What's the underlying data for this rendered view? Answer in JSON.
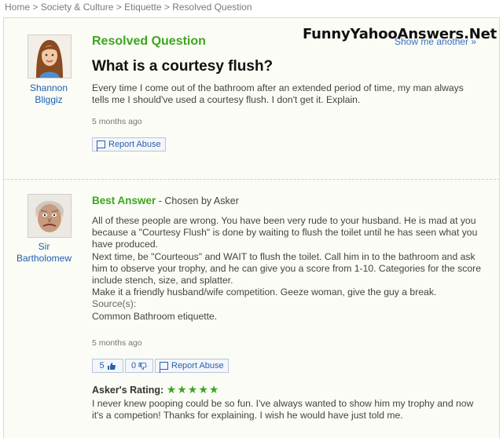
{
  "breadcrumb": {
    "items": [
      "Home",
      "Society & Culture",
      "Etiquette"
    ],
    "separator": ">",
    "current": "Resolved Question"
  },
  "watermark": "FunnyYahooAnswers.Net",
  "show_more": "Show me another »",
  "question": {
    "section_label": "Resolved Question",
    "title": "What is a courtesy flush?",
    "asker": {
      "name_line1": "Shannon",
      "name_line2": "Bliggiz"
    },
    "body": "Every time I come out of the bathroom after an extended period of time, my man always tells me I should've used a courtesy flush. I don't get it. Explain.",
    "time": "5 months ago",
    "report_label": "Report Abuse"
  },
  "answer": {
    "section_label": "Best Answer",
    "chosen_by": " - Chosen by Asker",
    "answerer": {
      "name_line1": "Sir",
      "name_line2": "Bartholomew"
    },
    "paragraphs": [
      "All of these people are wrong. You have been very rude to your husband. He is mad at you because a \"Courtesy Flush\" is done by waiting to flush the toilet until he has seen what you have produced.",
      "Next time, be \"Courteous\" and WAIT to flush the toilet. Call him in to the bathroom and ask him to observe your trophy, and he can give you a score from 1-10. Categories for the score include stench, size, and splatter.",
      "Make it a friendly husband/wife competition. Geeze woman, give the guy a break."
    ],
    "sources_label": "Source(s):",
    "source": "Common Bathroom etiquette.",
    "time": "5 months ago",
    "thumbs_up": "5",
    "thumbs_down": "0",
    "report_label": "Report Abuse",
    "rating_label": "Asker's Rating:",
    "rating_stars": "★★★★★",
    "rating_value": 5,
    "rating_comment": "I never knew pooping could be so fun. I've always wanted to show him my trophy and now it's a competion! Thanks for explaining. I wish he would have just told me."
  },
  "colors": {
    "accent_green": "#3fa520",
    "link_blue": "#1e5fb4"
  }
}
